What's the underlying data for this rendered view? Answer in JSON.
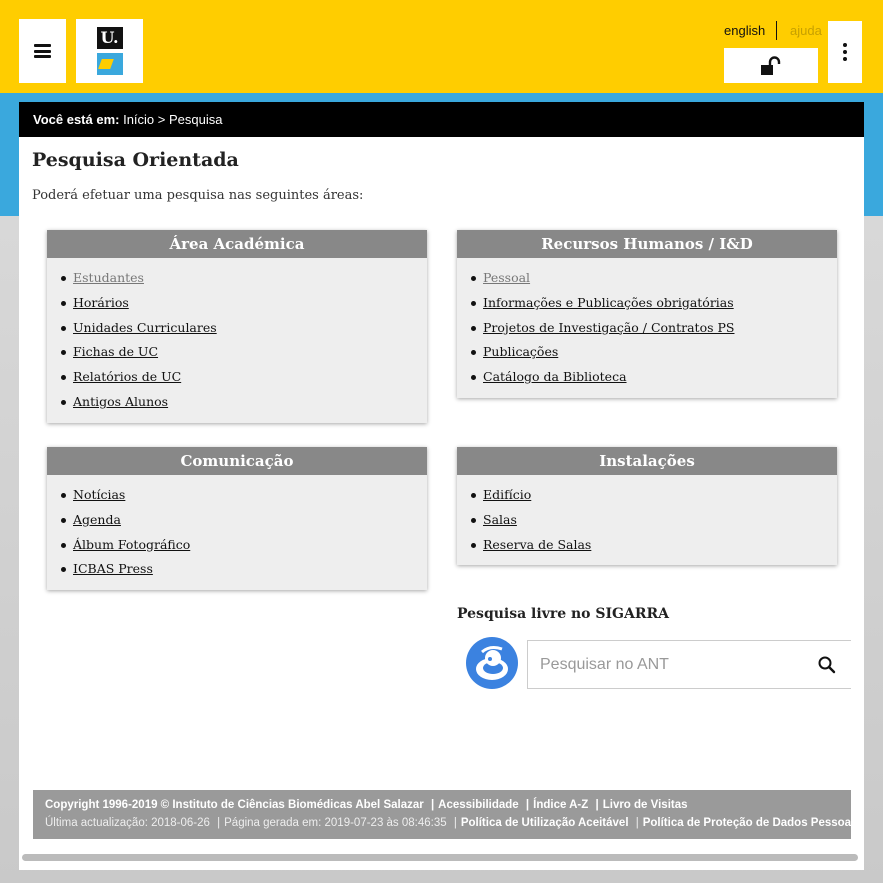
{
  "header": {
    "logo_text": "U.",
    "lang_label": "english",
    "help_label": "ajuda",
    "icons": [
      "hamburger-menu-icon",
      "unlock-icon",
      "kebab-menu-icon"
    ]
  },
  "breadcrumb": {
    "prefix": "Você está em:",
    "home": "Início",
    "separator": " > ",
    "current": "Pesquisa"
  },
  "main": {
    "title": "Pesquisa Orientada",
    "intro": "Poderá efetuar uma pesquisa nas seguintes áreas:",
    "sections": [
      {
        "title": "Área Académica",
        "items": [
          "Estudantes",
          "Horários",
          "Unidades Curriculares",
          "Fichas de UC",
          "Relatórios de UC",
          "Antigos Alunos"
        ]
      },
      {
        "title": "Recursos Humanos / I&D",
        "items": [
          "Pessoal",
          "Informações e Publicações obrigatórias",
          "Projetos de Investigação / Contratos PS",
          "Publicações",
          "Catálogo da Biblioteca"
        ]
      },
      {
        "title": "Comunicação",
        "items": [
          "Notícias",
          "Agenda",
          "Álbum Fotográfico",
          "ICBAS Press"
        ]
      },
      {
        "title": "Instalações",
        "items": [
          "Edifício",
          "Salas",
          "Reserva de Salas"
        ]
      }
    ],
    "free_search": {
      "title": "Pesquisa livre no SIGARRA",
      "placeholder": "Pesquisar no ANT"
    }
  },
  "footer": {
    "copyright": "Copyright 1996-2019 © Instituto de Ciências Biomédicas Abel Salazar",
    "links1": [
      "Acessibilidade",
      "Índice A-Z",
      "Livro de Visitas"
    ],
    "last_update": "Última actualização: 2018-06-26",
    "generated": "Página gerada em: 2019-07-23 às 08:46:35",
    "links2": [
      "Política de Utilização Aceitável",
      "Política de Proteção de Dados Pessoais"
    ]
  },
  "colors": {
    "brand_yellow": "#ffcd00",
    "brand_blue": "#3aa8dd",
    "box_header": "#888888"
  }
}
